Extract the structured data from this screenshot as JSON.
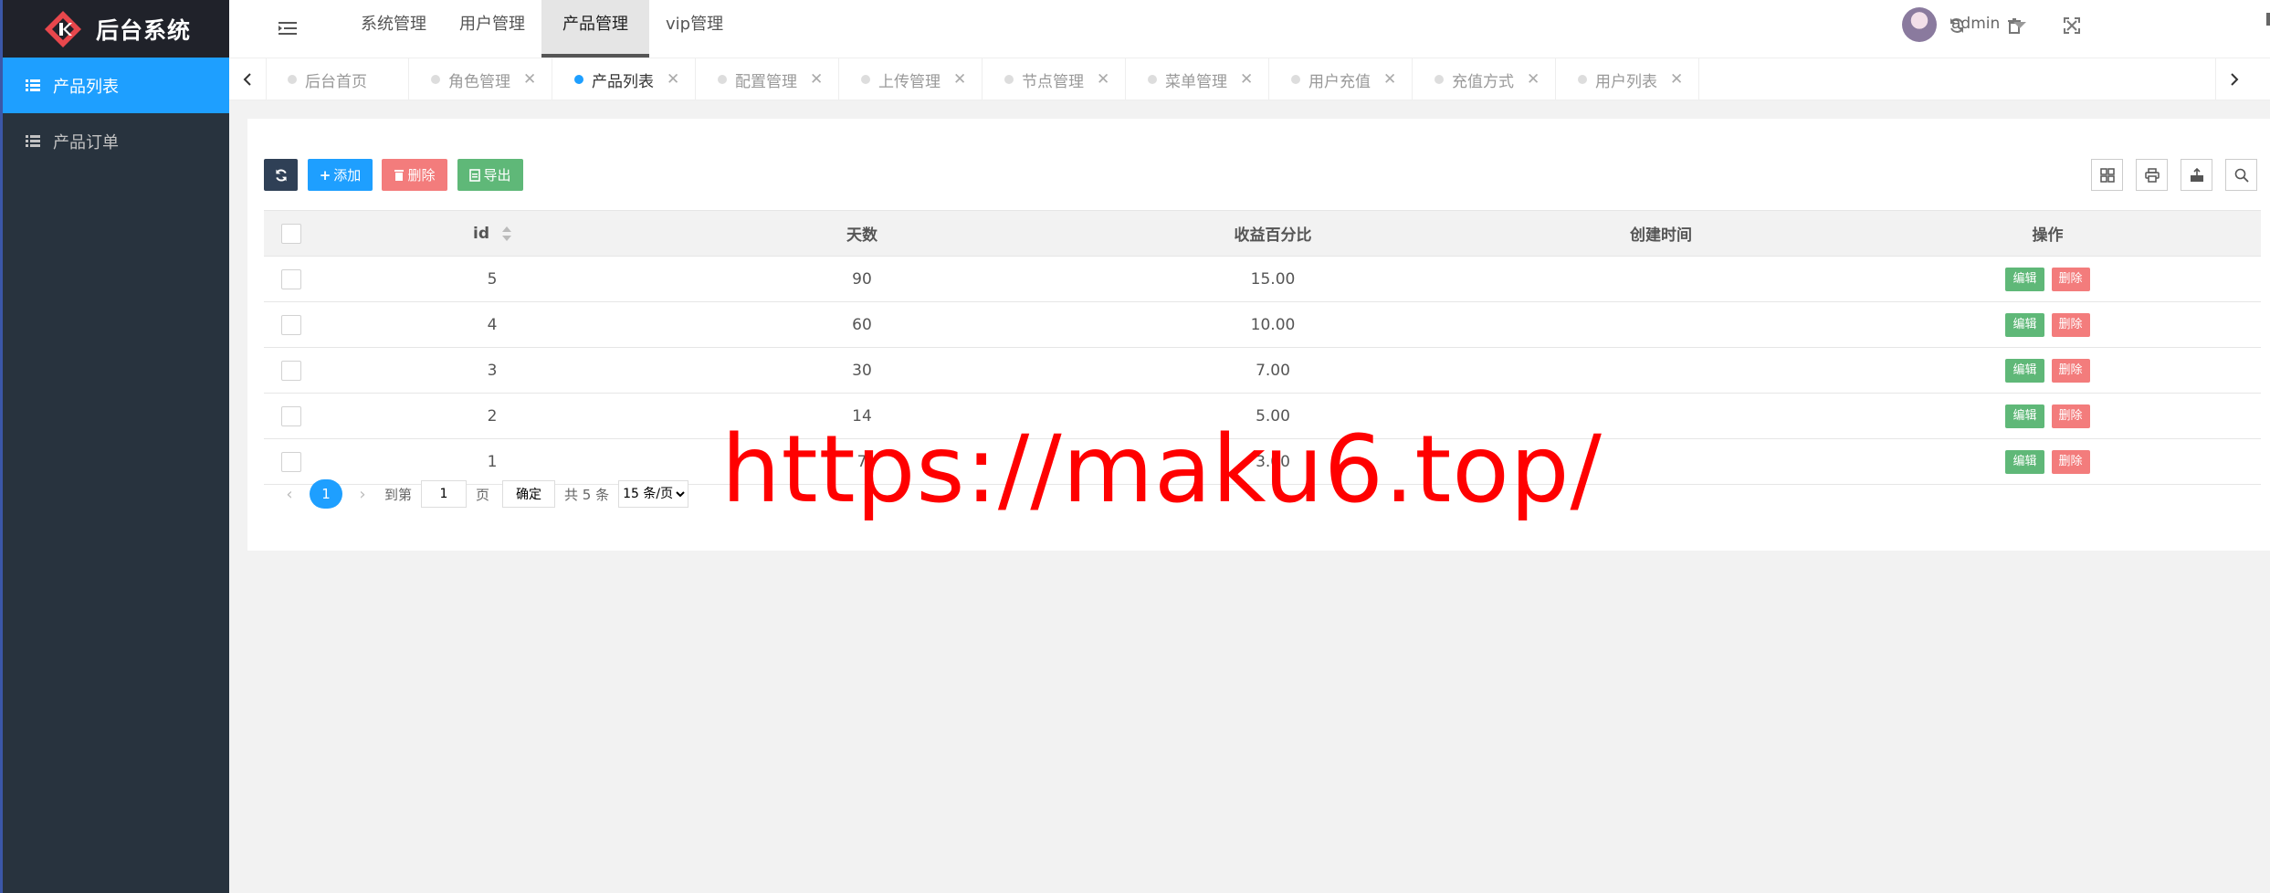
{
  "app": {
    "title": "后台系统"
  },
  "sidebar": {
    "items": [
      {
        "label": "产品列表",
        "active": true
      },
      {
        "label": "产品订单",
        "active": false
      }
    ]
  },
  "header": {
    "nav": [
      {
        "label": "系统管理",
        "active": false
      },
      {
        "label": "用户管理",
        "active": false
      },
      {
        "label": "产品管理",
        "active": true
      },
      {
        "label": "vip管理",
        "active": false
      }
    ],
    "icons": [
      "refresh-icon",
      "trash-icon",
      "fullscreen-icon"
    ],
    "user": {
      "name": "admin"
    }
  },
  "tabs": [
    {
      "label": "后台首页",
      "closable": false,
      "active": false
    },
    {
      "label": "角色管理",
      "closable": true,
      "active": false
    },
    {
      "label": "产品列表",
      "closable": true,
      "active": true
    },
    {
      "label": "配置管理",
      "closable": true,
      "active": false
    },
    {
      "label": "上传管理",
      "closable": true,
      "active": false
    },
    {
      "label": "节点管理",
      "closable": true,
      "active": false
    },
    {
      "label": "菜单管理",
      "closable": true,
      "active": false
    },
    {
      "label": "用户充值",
      "closable": true,
      "active": false
    },
    {
      "label": "充值方式",
      "closable": true,
      "active": false
    },
    {
      "label": "用户列表",
      "closable": true,
      "active": false
    }
  ],
  "toolbar": {
    "add_label": "添加",
    "delete_label": "删除",
    "export_label": "导出",
    "right_icons": [
      "columns-icon",
      "print-icon",
      "export-file-icon",
      "search-icon"
    ]
  },
  "table": {
    "columns": [
      "id",
      "天数",
      "收益百分比",
      "创建时间",
      "操作"
    ],
    "rows": [
      {
        "id": "5",
        "days": "90",
        "rate": "15.00",
        "created": ""
      },
      {
        "id": "4",
        "days": "60",
        "rate": "10.00",
        "created": ""
      },
      {
        "id": "3",
        "days": "30",
        "rate": "7.00",
        "created": ""
      },
      {
        "id": "2",
        "days": "14",
        "rate": "5.00",
        "created": ""
      },
      {
        "id": "1",
        "days": "7",
        "rate": "3.00",
        "created": ""
      }
    ],
    "edit_label": "编辑",
    "delete_label": "删除"
  },
  "pagination": {
    "current": "1",
    "goto_label": "到第",
    "goto_value": "1",
    "page_unit": "页",
    "confirm_label": "确定",
    "total_label": "共 5 条",
    "page_size": "15 条/页"
  },
  "watermark": {
    "text": "https://maku6.top/",
    "color": "#ff0000"
  },
  "colors": {
    "primary": "#1e9fff",
    "sidebar": "#28333e",
    "success": "#5fb878",
    "danger": "#f37c7c",
    "dark": "#2f4056"
  }
}
